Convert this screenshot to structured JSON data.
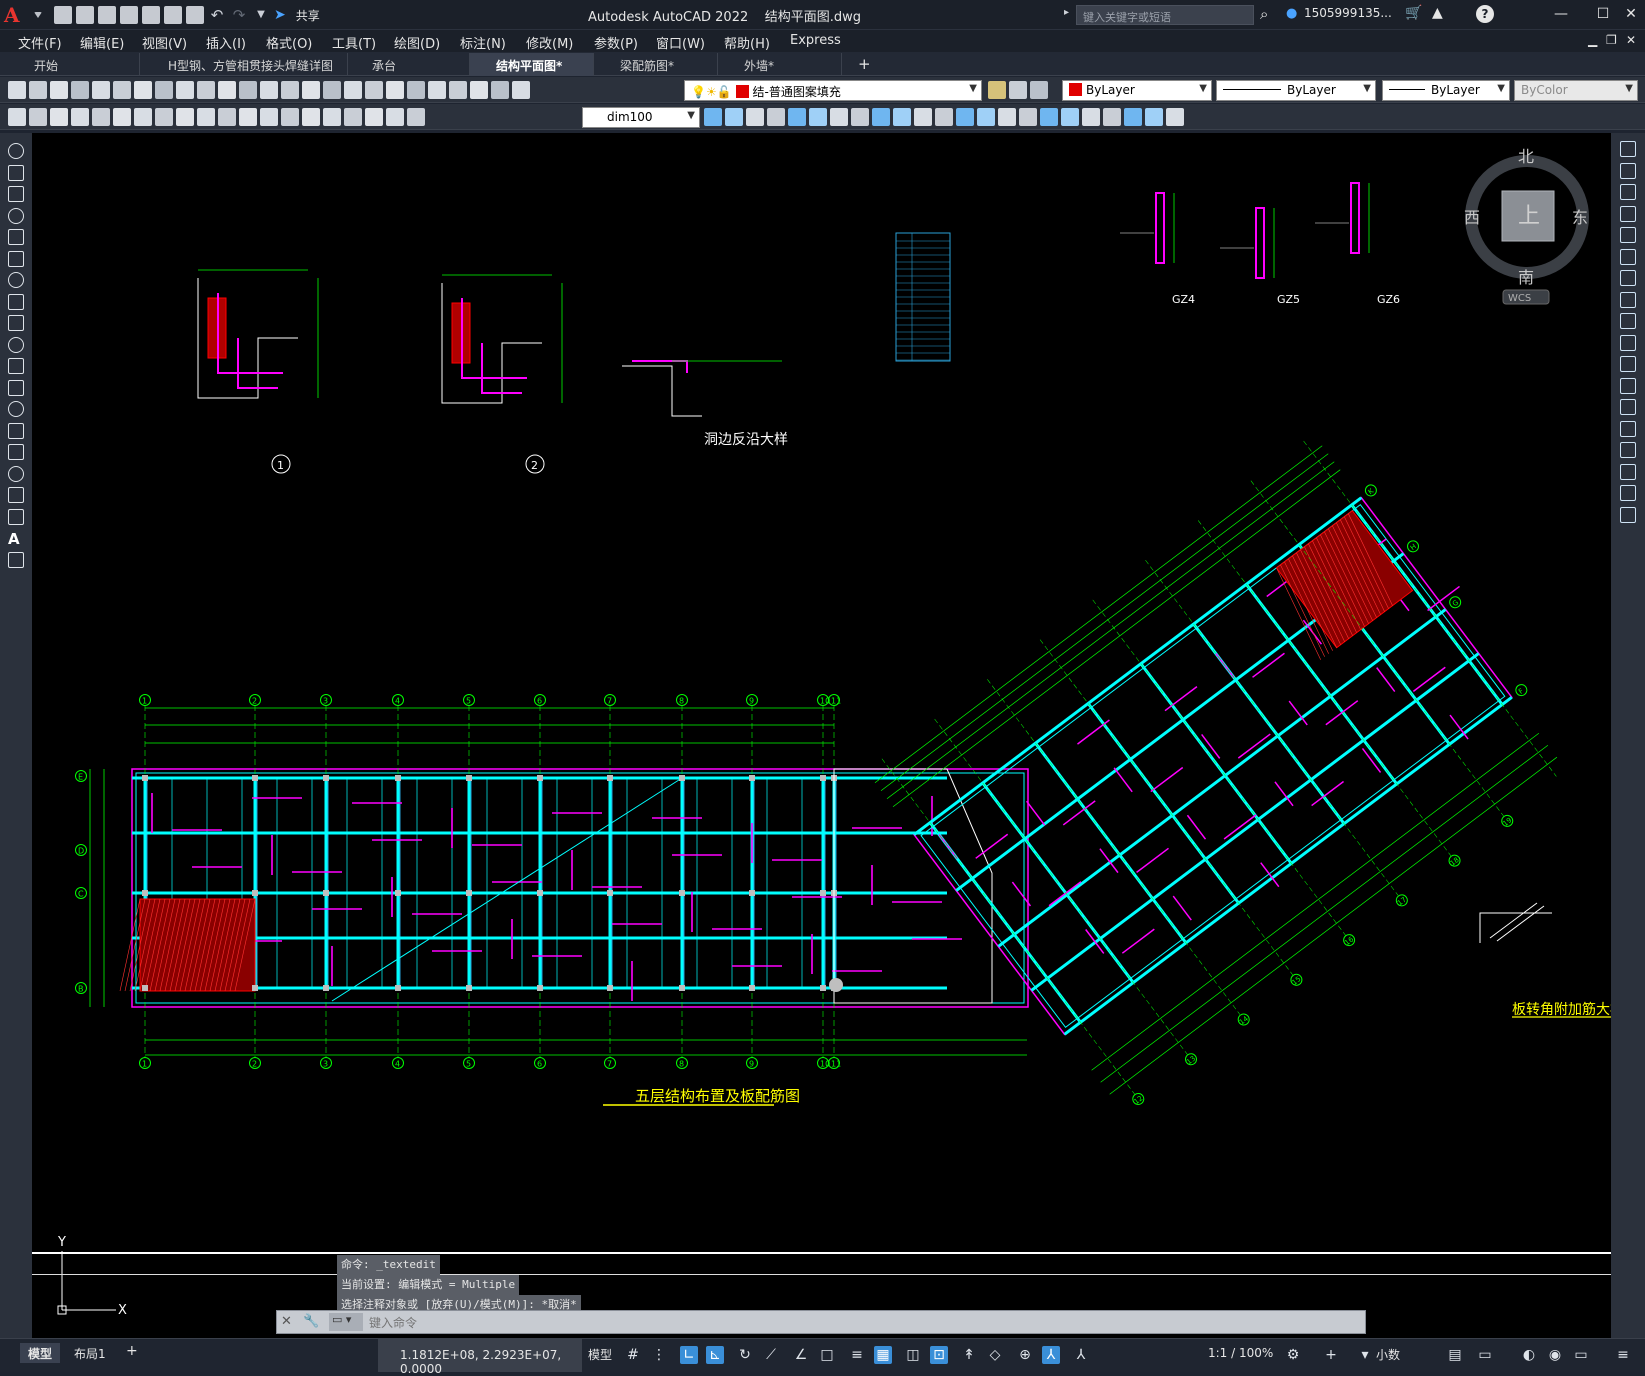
{
  "app": {
    "logo": "A",
    "title": "Autodesk AutoCAD 2022    结构平面图.dwg",
    "share_label": "共享",
    "search_placeholder": "键入关键字或短语",
    "account": "1505999135...",
    "help": "?"
  },
  "menu": [
    "文件(F)",
    "编辑(E)",
    "视图(V)",
    "插入(I)",
    "格式(O)",
    "工具(T)",
    "绘图(D)",
    "标注(N)",
    "修改(M)",
    "参数(P)",
    "窗口(W)",
    "帮助(H)",
    "Express"
  ],
  "tabs": [
    {
      "label": "开始",
      "active": false
    },
    {
      "label": "H型钢、方管相贯接头焊缝详图",
      "active": false
    },
    {
      "label": "承台",
      "active": false
    },
    {
      "label": "结构平面图*",
      "active": true
    },
    {
      "label": "梁配筋图*",
      "active": false
    },
    {
      "label": "外墙*",
      "active": false
    }
  ],
  "toolbar": {
    "layer_name": "结-普通图案填充",
    "color": "ByLayer",
    "linetype": "ByLayer",
    "lineweight": "ByLayer",
    "plotstyle": "ByColor",
    "dimstyle": "dim100"
  },
  "viewcube": {
    "north": "北",
    "south": "南",
    "east": "东",
    "west": "西",
    "face": "上",
    "wcs": "WCS"
  },
  "drawing": {
    "main_title": "五层结构布置及板配筋图",
    "detail_title_1": "洞边反沿大样",
    "detail_title_2": "板转角附加筋大样",
    "detail_1": "1",
    "detail_2": "2",
    "column_labels": [
      "GZ4",
      "GZ5",
      "GZ6"
    ],
    "grid_numbers_top": [
      "1",
      "2",
      "3",
      "4",
      "5",
      "6",
      "7",
      "8",
      "9",
      "10",
      "11"
    ],
    "grid_letters_left": [
      "E",
      "D",
      "C",
      "B"
    ],
    "grid_bubbles_angled": [
      "12",
      "13",
      "14",
      "15",
      "16",
      "17",
      "18",
      "19"
    ],
    "grid_letters_angled": [
      "K",
      "H",
      "G",
      "F"
    ],
    "ucs_y": "Y",
    "ucs_x": "X",
    "colors": {
      "grid": "#00ff00",
      "beam": "#00ffff",
      "rebar": "#ff00ff",
      "hatch": "#ff0000",
      "title": "#ffff00",
      "dims": "#00ff00",
      "text": "#ffffff"
    }
  },
  "command": {
    "history": [
      "命令:  _textedit",
      "当前设置: 编辑模式 = Multiple",
      "选择注释对象或 [放弃(U)/模式(M)]: *取消*"
    ],
    "placeholder": "键入命令"
  },
  "status": {
    "model_tab": "模型",
    "layout_tab": "布局1",
    "coordinates": "1.1812E+08, 2.2923E+07, 0.0000",
    "space": "模型",
    "scale": "1:1 / 100%",
    "units": "小数"
  }
}
